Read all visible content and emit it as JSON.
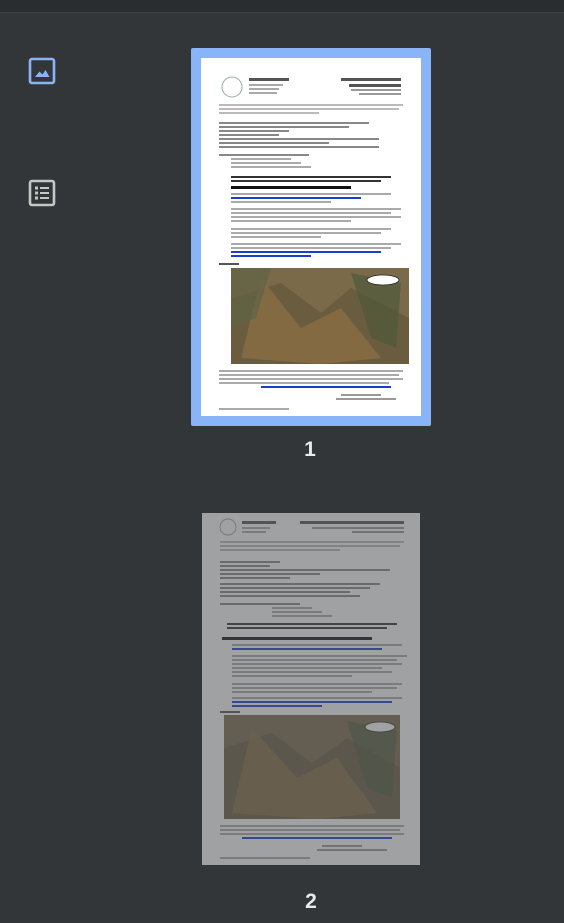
{
  "colors": {
    "background": "#323639",
    "topbar": "#2a2d2f",
    "selected_border": "#8ab4f8",
    "icon_accent": "#8ab4f8",
    "icon_muted": "#c4c7c5",
    "text": "#e8eaed"
  },
  "sidebar": {
    "thumbnails_button": {
      "icon": "image-icon",
      "active": true
    },
    "outline_button": {
      "icon": "list-icon",
      "active": false
    }
  },
  "pages": [
    {
      "label": "1",
      "selected": true
    },
    {
      "label": "2",
      "selected": false
    }
  ]
}
